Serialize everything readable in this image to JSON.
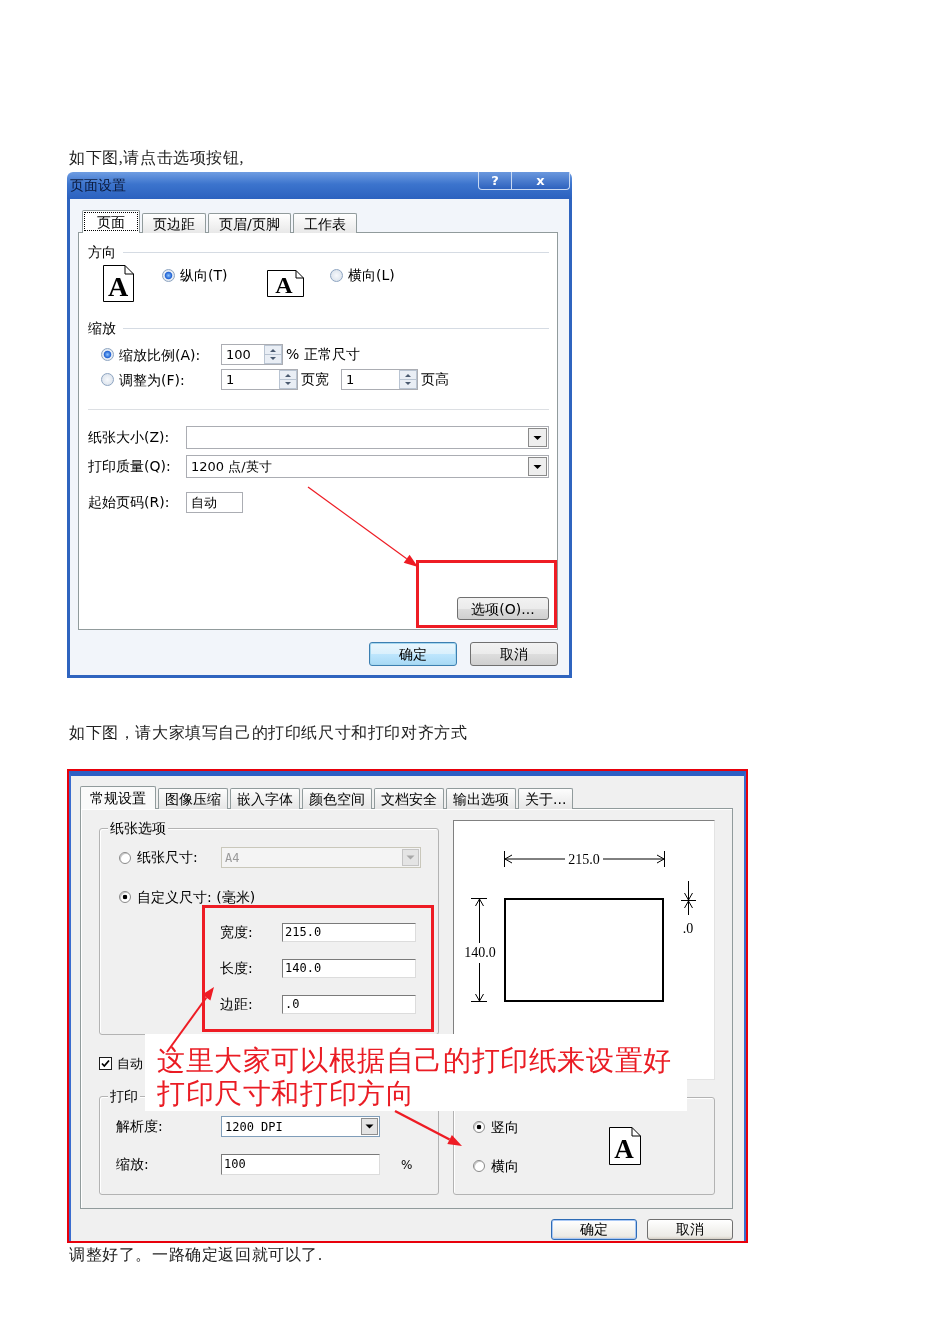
{
  "intro_text": "如下图,请点击选项按钮,",
  "page_setup": {
    "title": "页面设置",
    "caption_buttons": [
      {
        "kind": "help",
        "label": "?"
      },
      {
        "kind": "close",
        "label": "x"
      }
    ],
    "tabs": [
      {
        "label": "页面",
        "selected": true
      },
      {
        "label": "页边距",
        "selected": false
      },
      {
        "label": "页眉/页脚",
        "selected": false
      },
      {
        "label": "工作表",
        "selected": false
      }
    ],
    "orientation": {
      "heading": "方向",
      "options": [
        {
          "kind": "portrait",
          "glyph": "A",
          "label": "纵向(T)",
          "selected": true
        },
        {
          "kind": "landscape",
          "glyph": "A",
          "label": "横向(L)",
          "selected": false
        }
      ]
    },
    "scaling": {
      "heading": "缩放",
      "options": [
        {
          "label": "缩放比例(A):",
          "selected": true,
          "fields": [
            {
              "value": "100",
              "after": "% 正常尺寸"
            }
          ]
        },
        {
          "label": "调整为(F):",
          "selected": false,
          "fields": [
            {
              "value": "1",
              "after": "页宽"
            },
            {
              "value": "1",
              "after": "页高"
            }
          ]
        }
      ]
    },
    "settings": [
      {
        "kind": "select",
        "label": "纸张大小(Z):"
      },
      {
        "kind": "select",
        "label": "打印质量(Q):",
        "value": "1200 点/英寸"
      },
      {
        "kind": "input",
        "label": "起始页码(R):",
        "value": "自动"
      }
    ],
    "options_button": "选项(O)...",
    "buttons": [
      {
        "label": "确定",
        "default": true
      },
      {
        "label": "取消",
        "default": false
      }
    ]
  },
  "instruction_text": "如下图，请大家填写自己的打印纸尺寸和打印对齐方式",
  "pdf_settings": {
    "tabs": [
      {
        "label": "常规设置",
        "selected": true
      },
      {
        "label": "图像压缩",
        "selected": false
      },
      {
        "label": "嵌入字体",
        "selected": false
      },
      {
        "label": "颜色空间",
        "selected": false
      },
      {
        "label": "文档安全",
        "selected": false
      },
      {
        "label": "输出选项",
        "selected": false
      },
      {
        "label": "关于...",
        "selected": false
      }
    ],
    "paper_options": {
      "title": "纸张选项",
      "options": [
        {
          "label": "纸张尺寸:",
          "selected": false,
          "value": "A4",
          "disabled": true
        },
        {
          "label": "自定义尺寸: (毫米)",
          "selected": true
        }
      ],
      "custom_fields": [
        {
          "label": "宽度:",
          "value": "215.0"
        },
        {
          "label": "长度:",
          "value": "140.0"
        },
        {
          "label": "边距:",
          "value": ".0"
        }
      ]
    },
    "preview": {
      "width_label": "215.0",
      "height_label": "140.0",
      "margin_label": ".0"
    },
    "auto_checkbox": {
      "label": "自动",
      "checked": true
    },
    "print_group": {
      "title": "打印",
      "fields": [
        {
          "kind": "select",
          "label": "解析度:",
          "value": "1200 DPI"
        },
        {
          "kind": "input",
          "label": "缩放:",
          "value": "100",
          "unit": "%"
        }
      ]
    },
    "orientation": {
      "glyph": "A",
      "options": [
        {
          "label": "竖向",
          "selected": true
        },
        {
          "label": "横向",
          "selected": false
        }
      ]
    },
    "buttons": [
      {
        "label": "确定",
        "default": true
      },
      {
        "label": "取消",
        "default": false
      }
    ],
    "callout": "这里大家可以根据自己的打印纸来设置好打印尺寸和打印方向"
  },
  "closing_text": "调整好了。一路确定返回就可以了."
}
